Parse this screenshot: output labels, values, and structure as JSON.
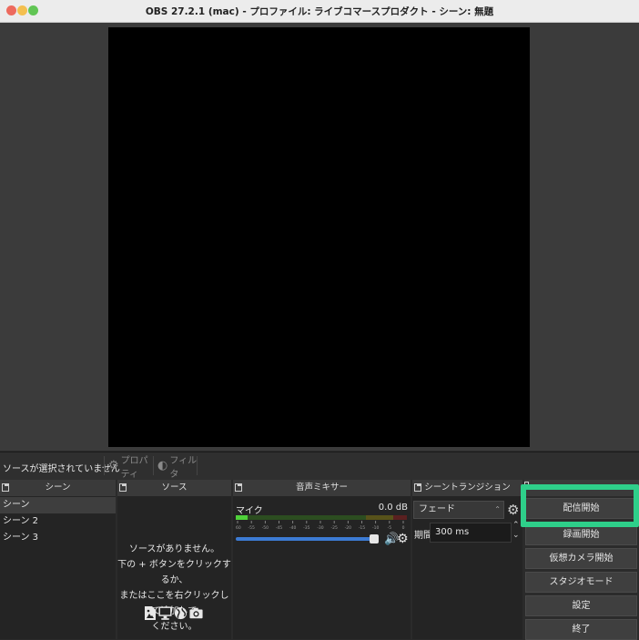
{
  "window": {
    "title": "OBS 27.2.1 (mac) - プロファイル: ライブコマースプロダクト - シーン: 無題",
    "traffic_lights": [
      "#ed6a5e",
      "#f4bf4f",
      "#61c554"
    ]
  },
  "context_bar": {
    "status": "ソースが選択されていません",
    "properties_label": "プロパティ",
    "filters_label": "フィルタ"
  },
  "scenes": {
    "title": "シーン",
    "items": [
      "シーン",
      "シーン 2",
      "シーン 3"
    ]
  },
  "sources": {
    "title": "ソース",
    "empty_lines": [
      "ソースがありません。",
      "下の + ボタンをクリックするか、",
      "またはここを右クリックして追加して",
      "ください。"
    ],
    "icons": [
      "image-icon",
      "display-icon",
      "globe-icon",
      "camera-icon"
    ]
  },
  "mixer": {
    "title": "音声ミキサー",
    "channel_name": "マイク",
    "level_db": "0.0 dB",
    "ticks": [
      "-60",
      "-55",
      "-50",
      "-45",
      "-40",
      "-35",
      "-30",
      "-25",
      "-20",
      "-15",
      "-10",
      "-5",
      "0"
    ],
    "meter_level": 0.07,
    "volume": 0.98
  },
  "transitions": {
    "title": "シーントランジション",
    "selected": "フェード",
    "duration_label": "期間",
    "duration_value": "300 ms"
  },
  "controls": {
    "buttons": [
      "配信開始",
      "録画開始",
      "仮想カメラ開始",
      "スタジオモード",
      "設定",
      "終了"
    ]
  },
  "highlight_color": "#2ecf8a"
}
